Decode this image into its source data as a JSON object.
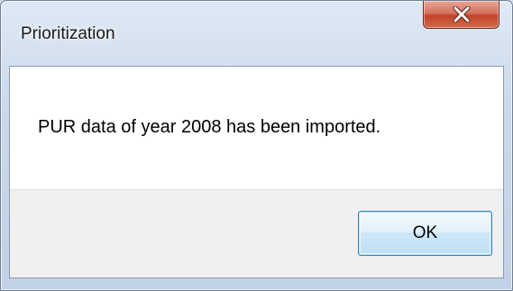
{
  "window": {
    "title": "Prioritization"
  },
  "title_bar": {
    "close_icon": "close-x-icon",
    "close_color": "#c4422a"
  },
  "dialog": {
    "message": "PUR data of year 2008 has been imported.",
    "ok_label": "OK"
  },
  "colors": {
    "frame": "#c9d8ea",
    "client": "#ffffff",
    "button_area": "#f0f0f0",
    "default_button_border": "#3c7fb1"
  }
}
